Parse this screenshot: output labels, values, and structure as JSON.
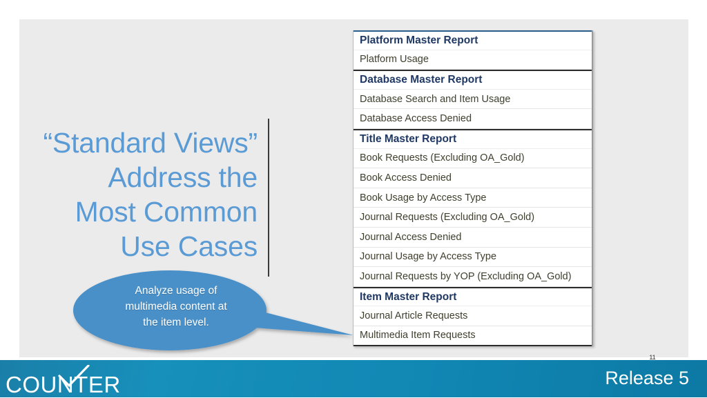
{
  "slide": {
    "headline": "“Standard Views”\nAddress the\nMost Common\nUse Cases",
    "slide_number": "11",
    "accent_blue": "#5B9BD5",
    "header_navy": "#1F3864",
    "row_olive": "#3F3F2D",
    "footer_teal": "#1187B4"
  },
  "callout": {
    "text": "Analyze usage of\nmultimedia content at\nthe item level."
  },
  "report_table": {
    "rows": [
      {
        "label": "Platform Master Report",
        "type": "header"
      },
      {
        "label": "Platform Usage",
        "type": "sub"
      },
      {
        "label": "Database Master Report",
        "type": "header"
      },
      {
        "label": "Database Search and Item Usage",
        "type": "sub"
      },
      {
        "label": "Database Access Denied",
        "type": "sub"
      },
      {
        "label": "Title Master Report",
        "type": "header"
      },
      {
        "label": "Book Requests (Excluding OA_Gold)",
        "type": "sub"
      },
      {
        "label": "Book Access Denied",
        "type": "sub"
      },
      {
        "label": "Book Usage by Access Type",
        "type": "sub"
      },
      {
        "label": "Journal Requests (Excluding OA_Gold)",
        "type": "sub"
      },
      {
        "label": "Journal Access Denied",
        "type": "sub"
      },
      {
        "label": "Journal Usage by Access Type",
        "type": "sub"
      },
      {
        "label": "Journal Requests by YOP (Excluding OA_Gold)",
        "type": "sub"
      },
      {
        "label": "Item Master Report",
        "type": "header"
      },
      {
        "label": "Journal Article Requests",
        "type": "sub"
      },
      {
        "label": "Multimedia Item Requests",
        "type": "sub"
      }
    ]
  },
  "footer": {
    "logo_text": "COUNTER",
    "release_label": "Release 5"
  }
}
